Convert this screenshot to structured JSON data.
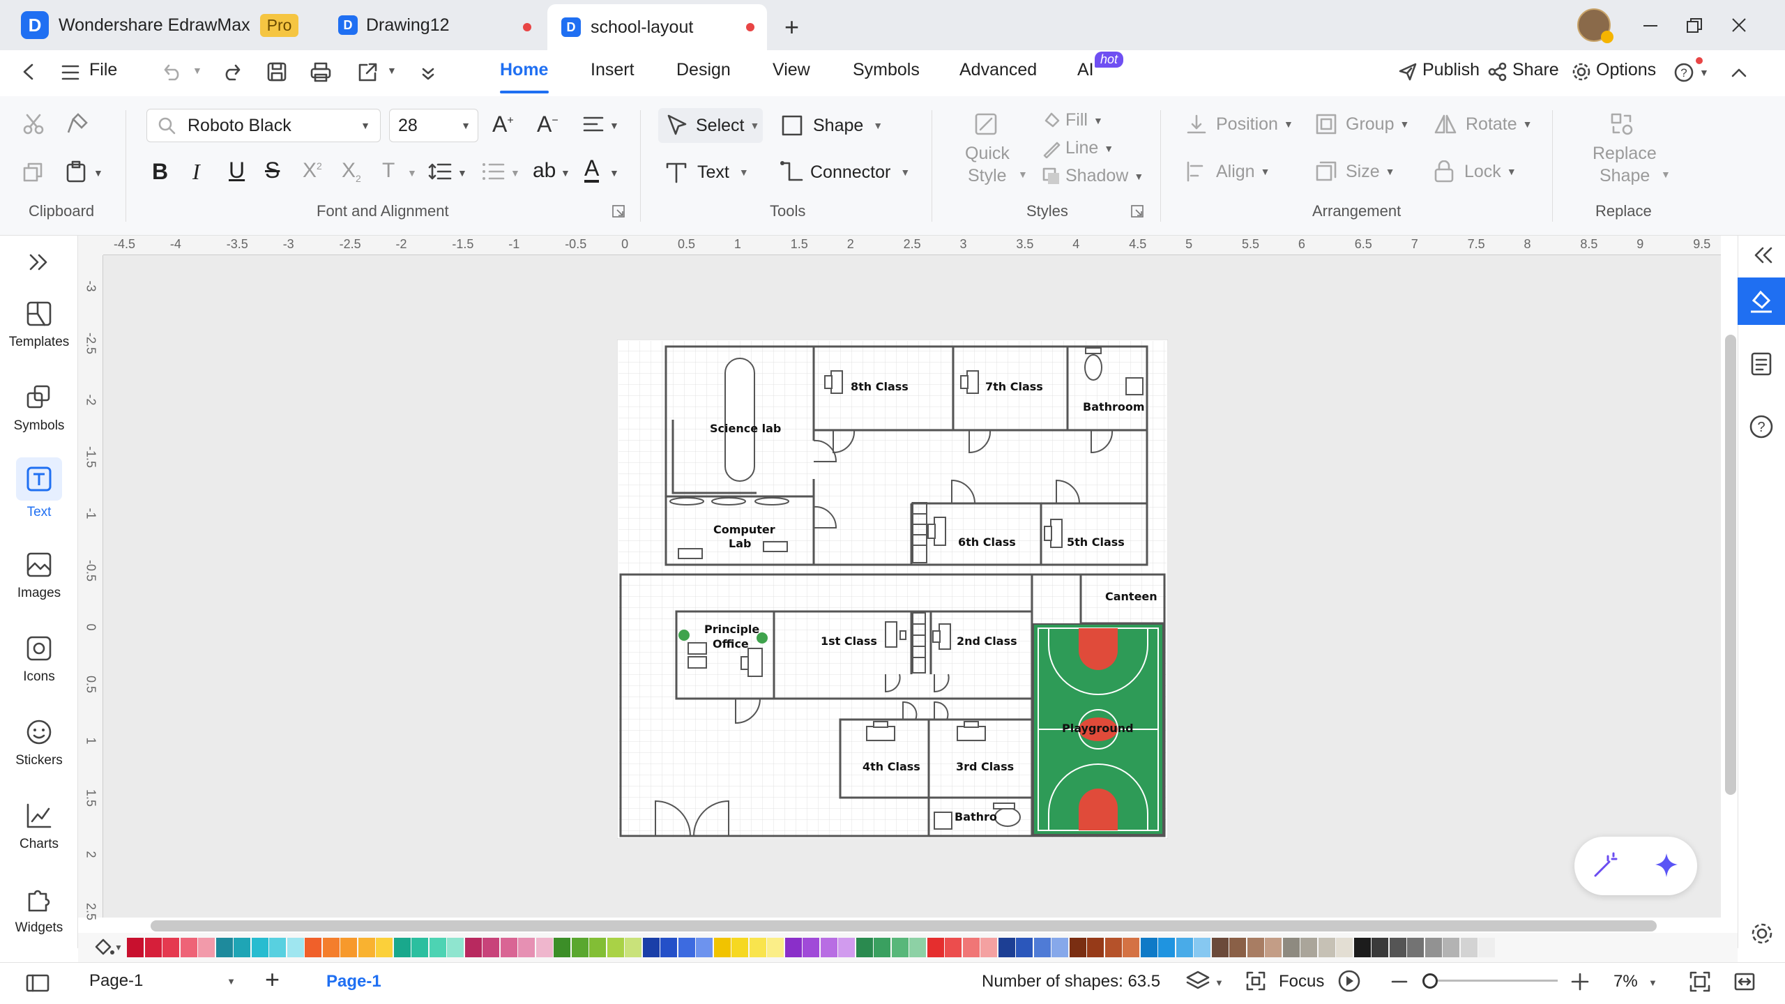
{
  "titlebar": {
    "app_name": "Wondershare EdrawMax",
    "pro_badge": "Pro",
    "tabs": [
      {
        "label": "Drawing12"
      },
      {
        "label": "school-layout"
      }
    ]
  },
  "menubar": {
    "file_label": "File",
    "tabs": [
      "Home",
      "Insert",
      "Design",
      "View",
      "Symbols",
      "Advanced",
      "AI"
    ],
    "active_tab": "Home",
    "ai_badge": "hot",
    "publish": "Publish",
    "share": "Share",
    "options": "Options"
  },
  "ribbon": {
    "clipboard_label": "Clipboard",
    "font_name": "Roboto Black",
    "font_size": "28",
    "font_group_label": "Font and Alignment",
    "select": "Select",
    "shape": "Shape",
    "text": "Text",
    "connector": "Connector",
    "tools_label": "Tools",
    "quick_style_1": "Quick",
    "quick_style_2": "Style",
    "fill": "Fill",
    "line": "Line",
    "shadow": "Shadow",
    "styles_label": "Styles",
    "position": "Position",
    "group": "Group",
    "rotate": "Rotate",
    "align": "Align",
    "size": "Size",
    "lock": "Lock",
    "arrangement_label": "Arrangement",
    "replace_shape_1": "Replace",
    "replace_shape_2": "Shape",
    "replace_label": "Replace"
  },
  "left_panel": {
    "items": [
      "Templates",
      "Symbols",
      "Text",
      "Images",
      "Icons",
      "Stickers",
      "Charts",
      "Widgets"
    ],
    "active": "Text"
  },
  "ruler": {
    "top_ticks": [
      "-4.5",
      "-4",
      "-3.5",
      "-3",
      "-2.5",
      "-2",
      "-1.5",
      "-1",
      "-0.5",
      "0",
      "0.5",
      "1",
      "1.5",
      "2",
      "2.5",
      "3",
      "3.5",
      "4",
      "4.5",
      "5",
      "5.5",
      "6",
      "6.5",
      "7",
      "7.5",
      "8",
      "8.5",
      "9",
      "9.5"
    ],
    "left_ticks": [
      "-3",
      "-2.5",
      "-2",
      "-1.5",
      "-1",
      "-0.5",
      "0",
      "0.5",
      "1",
      "1.5",
      "2",
      "2.5"
    ]
  },
  "floorplan": {
    "rooms": {
      "science_lab": "Science lab",
      "class_8": "8th Class",
      "class_7": "7th Class",
      "bathroom_top": "Bathroom",
      "computer_lab_1": "Computer",
      "computer_lab_2": "Lab",
      "class_6": "6th Class",
      "class_5": "5th Class",
      "canteen": "Canteen",
      "principle_1": "Principle",
      "principle_2": "Office",
      "class_1": "1st Class",
      "class_2": "2nd Class",
      "playground": "Playground",
      "class_4": "4th Class",
      "class_3": "3rd Class",
      "bathroom_bottom": "Bathro"
    },
    "colors": {
      "playground_green": "#2e9b57",
      "court_red": "#e04b3a"
    }
  },
  "statusbar": {
    "page_select": "Page-1",
    "page_tab": "Page-1",
    "shape_count": "Number of shapes: 63.5",
    "focus": "Focus",
    "zoom": "7%"
  },
  "palette": [
    "#c8102e",
    "#d61f3a",
    "#e5394f",
    "#ee6377",
    "#f29aaa",
    "#1e8a9c",
    "#1fa5b5",
    "#27bcd0",
    "#58d0e0",
    "#9fe6f0",
    "#f0602a",
    "#f47e2c",
    "#f7992b",
    "#f9b230",
    "#fbd03a",
    "#19a88c",
    "#2bbf9f",
    "#4dd3b3",
    "#8fe5cf",
    "#b8295f",
    "#c8437a",
    "#d96594",
    "#e690b3",
    "#efb6cd",
    "#3c8e28",
    "#5aa72f",
    "#82be35",
    "#a9d246",
    "#c9e27a",
    "#1a3fa8",
    "#2450c8",
    "#3d6be0",
    "#6d93ee",
    "#f1c300",
    "#f6d821",
    "#f9e44d",
    "#fbee88",
    "#8a2fc9",
    "#a04ad8",
    "#b86de3",
    "#d19bee",
    "#2a8a4f",
    "#3aa060",
    "#58b77a",
    "#8dd1a5",
    "#e52e2e",
    "#ec4d4d",
    "#f07676",
    "#f4a1a1",
    "#1d3f94",
    "#2b57bb",
    "#4f7bd6",
    "#86a8ea",
    "#7a2e12",
    "#963a18",
    "#b5522a",
    "#d47244",
    "#0f7ac7",
    "#1f94e0",
    "#49abe8",
    "#86c8f1",
    "#6b4a3a",
    "#8a6047",
    "#a87d63",
    "#c39d86",
    "#8e8a80",
    "#aaa59a",
    "#c6c1b5",
    "#e3ded3",
    "#1c1c1c",
    "#3a3a3a",
    "#555555",
    "#737373",
    "#929292",
    "#b3b3b3",
    "#d3d3d3",
    "#eeeeee"
  ]
}
